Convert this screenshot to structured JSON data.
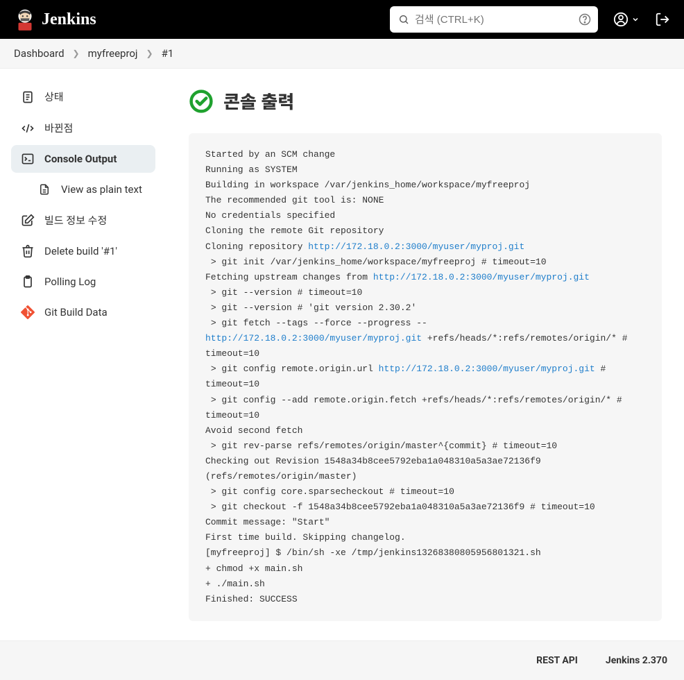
{
  "header": {
    "brand": "Jenkins",
    "search_placeholder": "검색 (CTRL+K)"
  },
  "breadcrumbs": [
    "Dashboard",
    "myfreeproj",
    "#1"
  ],
  "sidebar": {
    "status": "상태",
    "changes": "바뀐점",
    "console_output": "Console Output",
    "view_plain": "View as plain text",
    "edit_build": "빌드 정보 수정",
    "delete_build": "Delete build '#1'",
    "polling_log": "Polling Log",
    "git_data": "Git Build Data"
  },
  "page": {
    "title": "콘솔 출력"
  },
  "console": {
    "lines": [
      {
        "t": "Started by an SCM change"
      },
      {
        "t": "Running as SYSTEM"
      },
      {
        "t": "Building in workspace /var/jenkins_home/workspace/myfreeproj"
      },
      {
        "t": "The recommended git tool is: NONE"
      },
      {
        "t": "No credentials specified"
      },
      {
        "t": "Cloning the remote Git repository"
      },
      {
        "t": "Cloning repository ",
        "link": "http://172.18.0.2:3000/myuser/myproj.git"
      },
      {
        "t": " > git init /var/jenkins_home/workspace/myfreeproj # timeout=10"
      },
      {
        "t": "Fetching upstream changes from ",
        "link": "http://172.18.0.2:3000/myuser/myproj.git"
      },
      {
        "t": " > git --version # timeout=10"
      },
      {
        "t": " > git --version # 'git version 2.30.2'"
      },
      {
        "t": " > git fetch --tags --force --progress -- ",
        "link": "http://172.18.0.2:3000/myuser/myproj.git",
        "after": " +refs/heads/*:refs/remotes/origin/* # timeout=10"
      },
      {
        "t": " > git config remote.origin.url ",
        "link": "http://172.18.0.2:3000/myuser/myproj.git",
        "after": " # timeout=10"
      },
      {
        "t": " > git config --add remote.origin.fetch +refs/heads/*:refs/remotes/origin/* # timeout=10"
      },
      {
        "t": "Avoid second fetch"
      },
      {
        "t": " > git rev-parse refs/remotes/origin/master^{commit} # timeout=10"
      },
      {
        "t": "Checking out Revision 1548a34b8cee5792eba1a048310a5a3ae72136f9 (refs/remotes/origin/master)"
      },
      {
        "t": " > git config core.sparsecheckout # timeout=10"
      },
      {
        "t": " > git checkout -f 1548a34b8cee5792eba1a048310a5a3ae72136f9 # timeout=10"
      },
      {
        "t": "Commit message: \"Start\""
      },
      {
        "t": "First time build. Skipping changelog."
      },
      {
        "t": "[myfreeproj] $ /bin/sh -xe /tmp/jenkins13268380805956801321.sh"
      },
      {
        "t": "+ chmod +x main.sh"
      },
      {
        "t": "+ ./main.sh"
      },
      {
        "t": "Finished: SUCCESS"
      }
    ]
  },
  "footer": {
    "rest_api": "REST API",
    "version": "Jenkins 2.370"
  }
}
